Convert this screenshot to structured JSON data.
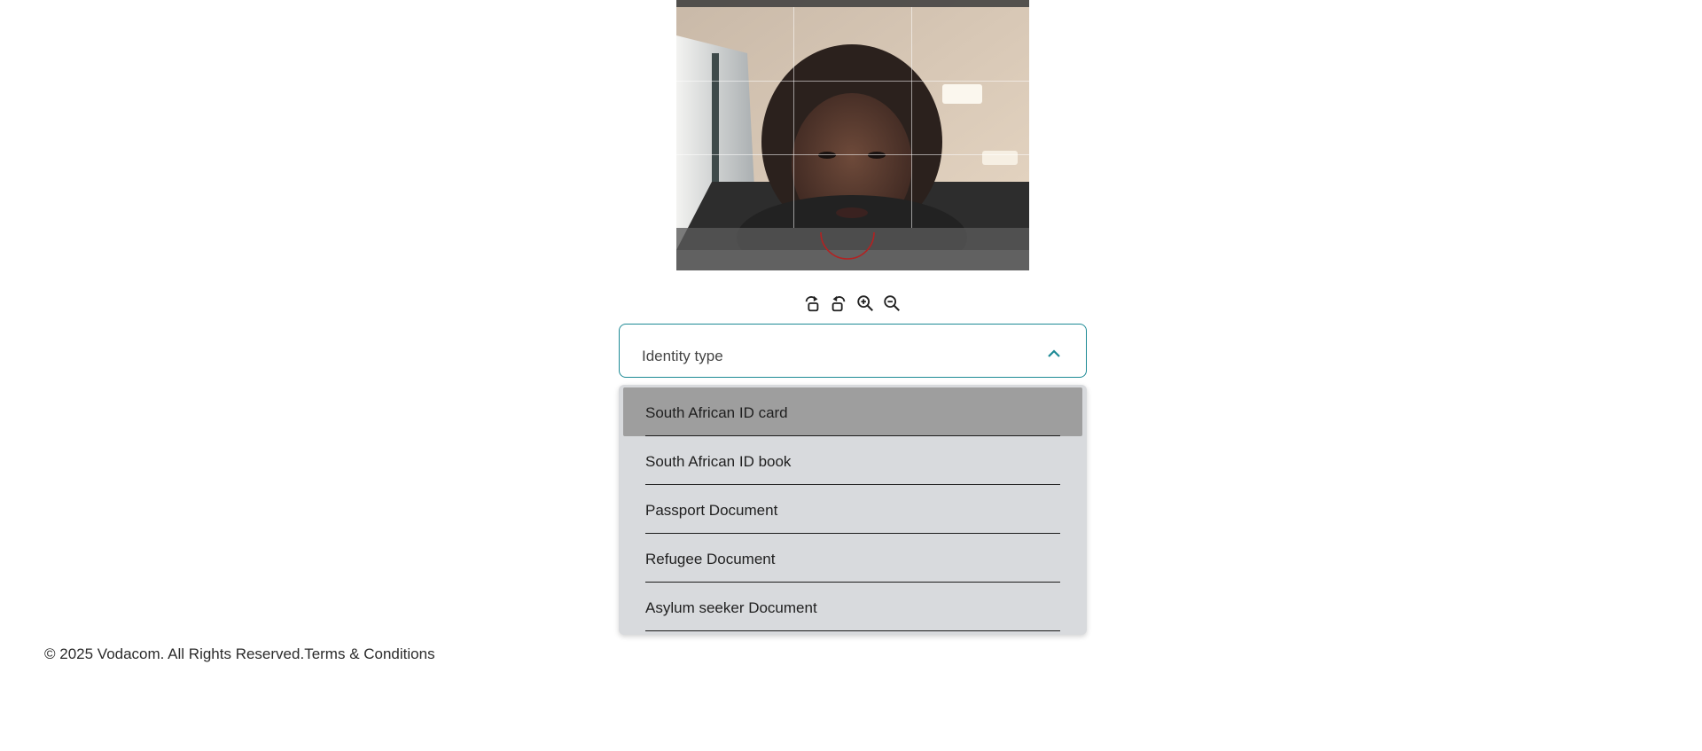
{
  "toolbar": {
    "icons": [
      "rotate-right-icon",
      "rotate-left-icon",
      "zoom-in-icon",
      "zoom-out-icon"
    ]
  },
  "identity_select": {
    "label": "Identity type",
    "expanded": true,
    "accent_color": "#1d8a95"
  },
  "dropdown": {
    "options": [
      {
        "label": "South African ID card",
        "highlighted": true
      },
      {
        "label": "South African ID book",
        "highlighted": false
      },
      {
        "label": "Passport Document",
        "highlighted": false
      },
      {
        "label": "Refugee Document",
        "highlighted": false
      },
      {
        "label": "Asylum seeker Document",
        "highlighted": false
      }
    ]
  },
  "footer": {
    "copyright": "© 2025 Vodacom. All Rights Reserved.",
    "terms_link": "Terms & Conditions"
  }
}
